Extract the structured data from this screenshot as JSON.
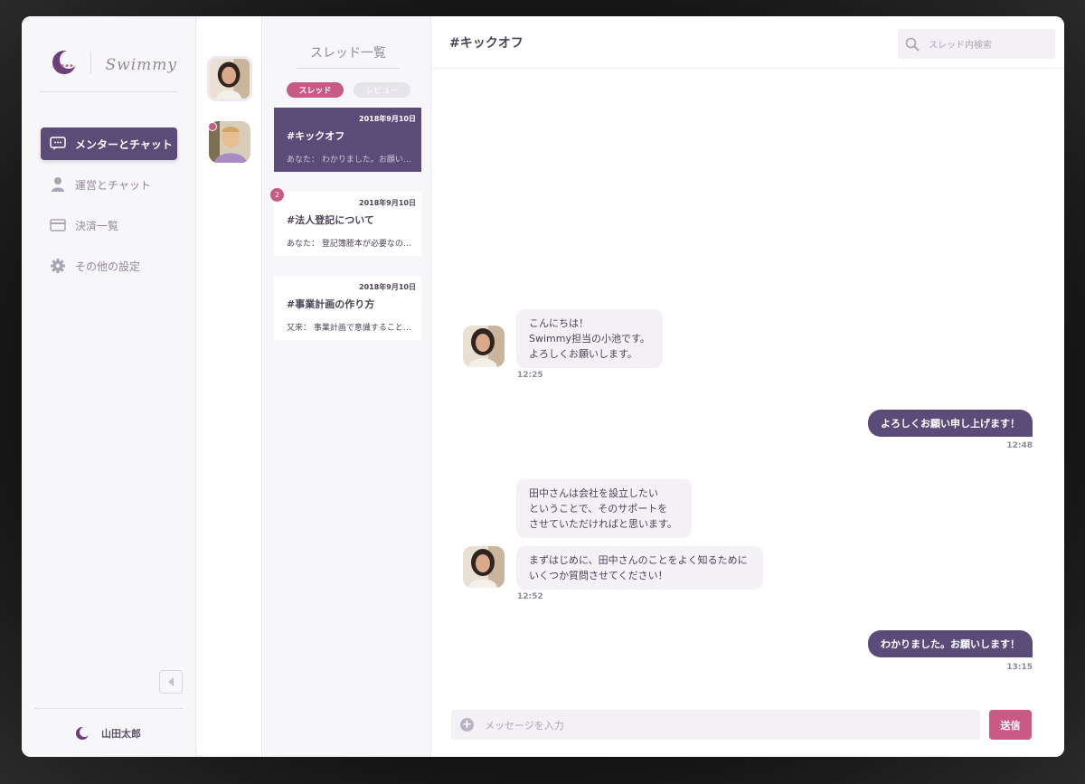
{
  "brand": {
    "logo_text": "Swimmy"
  },
  "sidebar": {
    "items": [
      {
        "label": "メンターとチャット",
        "icon": "chat-bubble-icon",
        "active": true
      },
      {
        "label": "運営とチャット",
        "icon": "person-icon",
        "active": false
      },
      {
        "label": "決済一覧",
        "icon": "credit-card-icon",
        "active": false
      },
      {
        "label": "その他の設定",
        "icon": "gear-icon",
        "active": false
      }
    ],
    "user_name": "山田太郎"
  },
  "threads": {
    "title": "スレッド一覧",
    "tabs": [
      {
        "label": "スレッド",
        "active": true
      },
      {
        "label": "レビュー",
        "active": false
      }
    ],
    "items": [
      {
        "date": "2018年9月10日",
        "title": "#キックオフ",
        "preview": "あなた： わかりました。お願いします！",
        "active": true,
        "badge": ""
      },
      {
        "date": "2018年9月10日",
        "title": "#法人登記について",
        "preview": "あなた： 登記簿謄本が必要なのですか？",
        "active": false,
        "badge": "2"
      },
      {
        "date": "2018年9月10日",
        "title": "#事業計画の作り方",
        "preview": "又来： 事業計画で意識することは？",
        "active": false,
        "badge": ""
      }
    ]
  },
  "chat": {
    "title": "#キックオフ",
    "search_placeholder": "スレッド内検索",
    "messages": [
      {
        "lines": [
          "こんにちは！",
          "Swimmy担当の小池です。",
          "よろしくお願いします。"
        ],
        "time": "12:25"
      },
      {
        "text": "よろしくお願い申し上げます！",
        "time": "12:48"
      },
      {
        "lines": [
          "田中さんは会社を設立したい",
          "ということで、そのサポートを",
          "させていただければと思います。"
        ]
      },
      {
        "lines": [
          "まずはじめに、田中さんのことをよく知るために",
          "いくつか質問させてください！"
        ],
        "time": "12:52"
      },
      {
        "text": "わかりました。お願いします！",
        "time": "13:15"
      }
    ],
    "input_placeholder": "メッセージを入力",
    "send_label": "送信"
  },
  "colors": {
    "accent": "#5b4b78",
    "pink": "#c85a85",
    "bg": "#f7f6f9"
  }
}
